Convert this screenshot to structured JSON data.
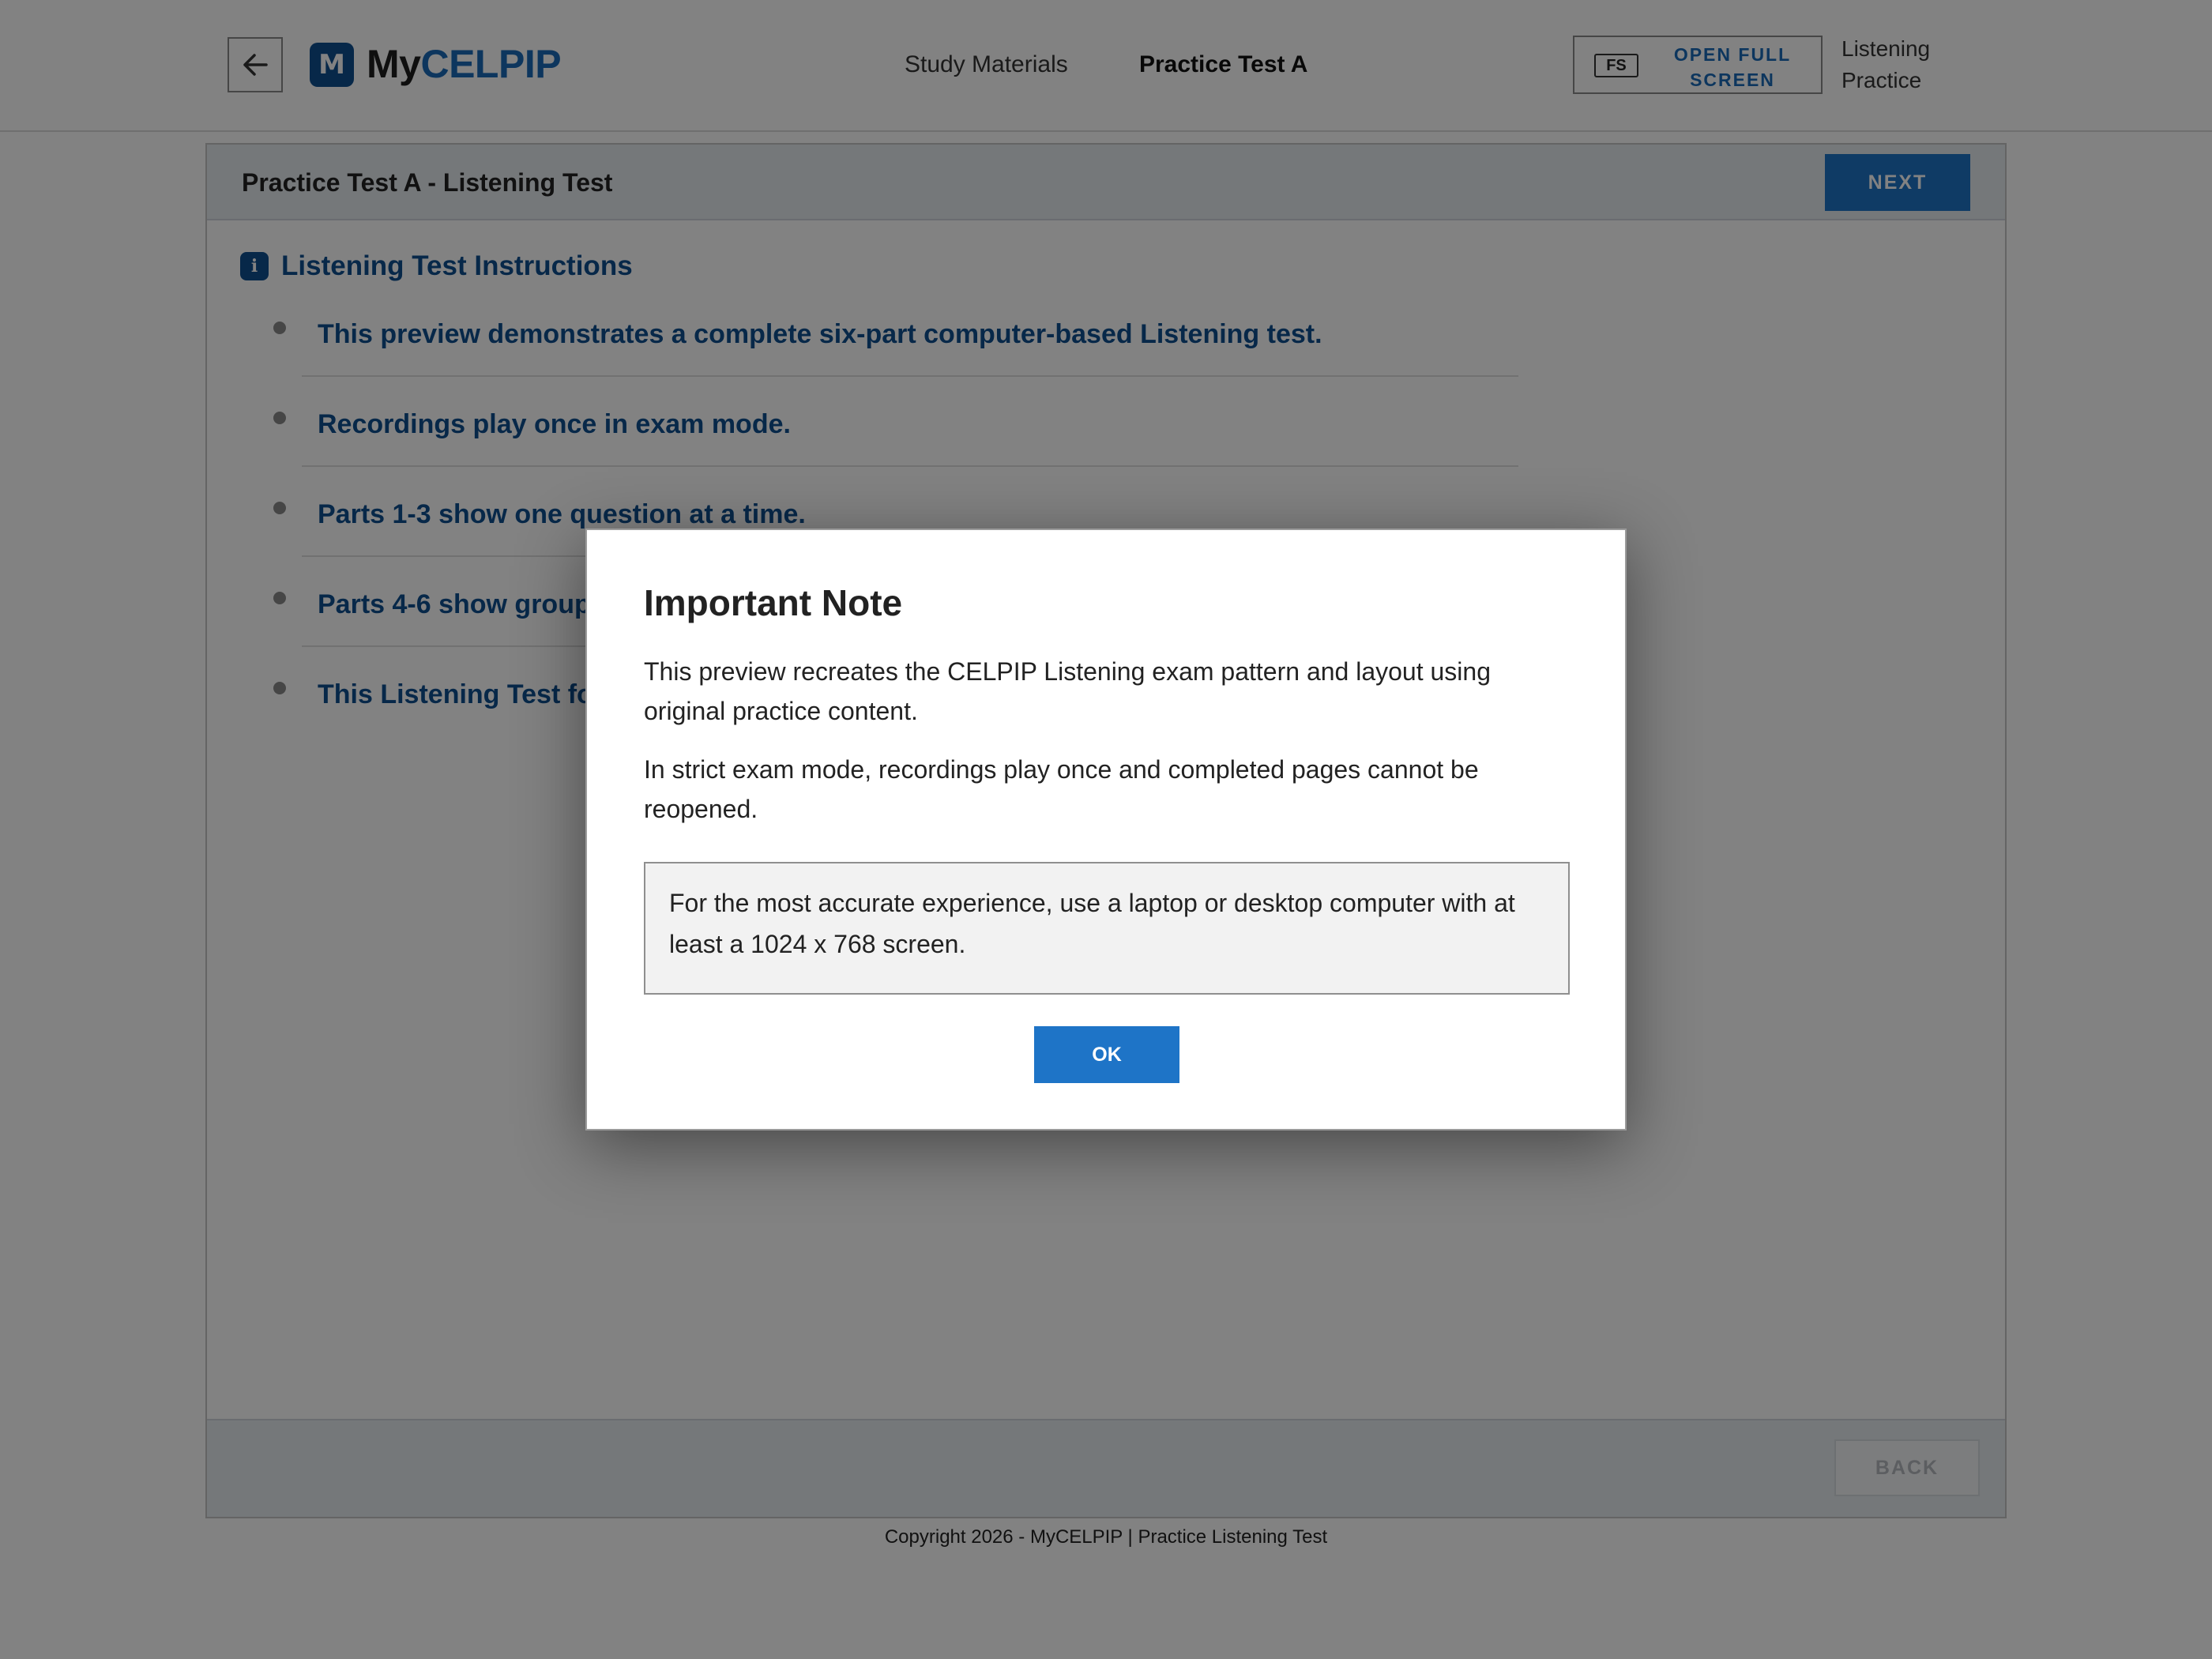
{
  "header": {
    "logo_mark": "M",
    "logo_prefix": "My",
    "logo_accent": "CELPIP",
    "nav": [
      {
        "label": "Study Materials"
      },
      {
        "label": "Practice Test A"
      }
    ],
    "fullscreen_badge": "FS",
    "fullscreen_label": "OPEN FULL SCREEN",
    "side_label": "Listening Practice"
  },
  "panel": {
    "title": "Practice Test A - Listening Test",
    "next_label": "NEXT",
    "back_label": "BACK",
    "instructions_title": "Listening Test Instructions",
    "info_icon_glyph": "i",
    "instructions": [
      "This preview demonstrates a complete six-part computer-based Listening test.",
      "Recordings play once in exam mode.",
      "Parts 1-3 show one question at a time.",
      "Parts 4-6 show grouped questions.",
      "This Listening Test follows the same part order and page screens."
    ]
  },
  "footer": {
    "copyright": "Copyright 2026 - MyCELPIP | Practice Listening Test"
  },
  "modal": {
    "title": "Important Note",
    "paragraph1": "This preview recreates the CELPIP Listening exam pattern and layout using original practice content.",
    "paragraph2": "In strict exam mode, recordings play once and completed pages cannot be reopened.",
    "note": "For the most accurate experience, use a laptop or desktop computer with at least a 1024 x 768 screen.",
    "ok_label": "OK"
  },
  "colors": {
    "brand_blue": "#1e74c7",
    "brand_dark": "#0f4f8f",
    "overlay": "rgba(0,0,0,0.49)"
  },
  "icons": {
    "back": "arrow-left-icon",
    "info": "info-icon"
  }
}
